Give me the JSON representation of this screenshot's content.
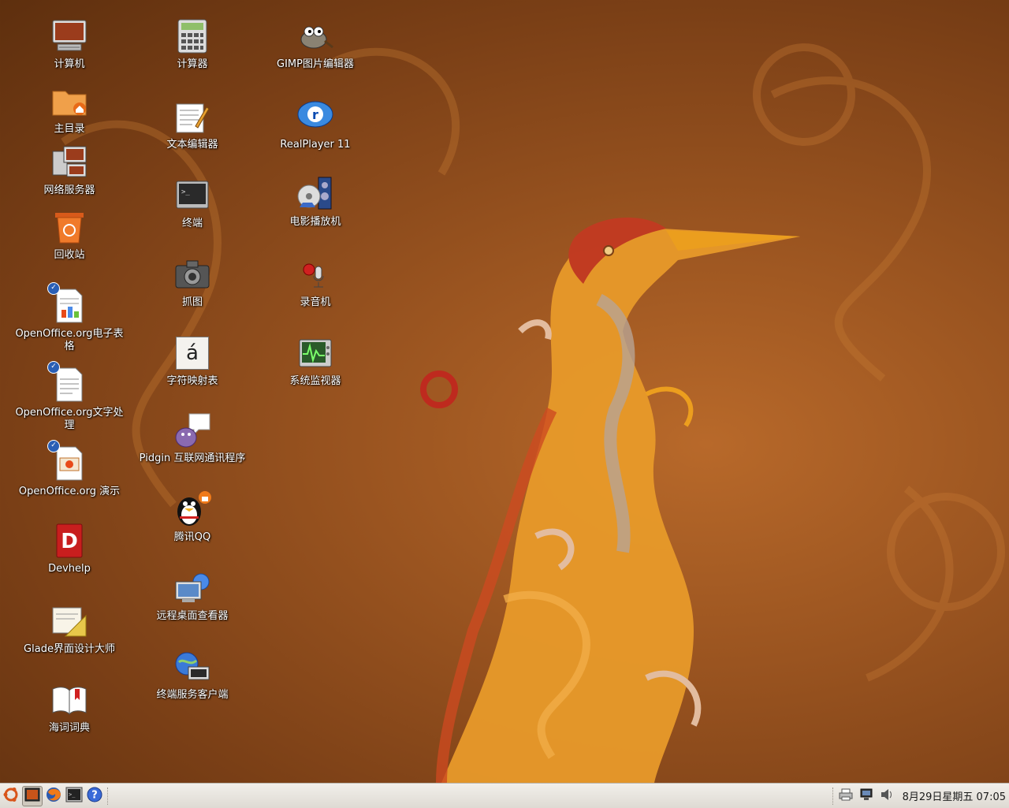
{
  "desktop": {
    "col1": [
      {
        "label": "计算机",
        "icon": "computer-icon"
      },
      {
        "label": "主目录",
        "icon": "home-folder-icon"
      },
      {
        "label": "网络服务器",
        "icon": "network-servers-icon"
      },
      {
        "label": "回收站",
        "icon": "trash-icon"
      },
      {
        "label": "OpenOffice.org电子表格",
        "icon": "spreadsheet-icon"
      },
      {
        "label": "OpenOffice.org文字处理",
        "icon": "word-processor-icon"
      },
      {
        "label": "OpenOffice.org 演示",
        "icon": "presentation-icon"
      },
      {
        "label": "Devhelp",
        "icon": "devhelp-icon"
      },
      {
        "label": "Glade界面设计大师",
        "icon": "glade-icon"
      },
      {
        "label": "海词词典",
        "icon": "dictionary-icon"
      }
    ],
    "col2": [
      {
        "label": "计算器",
        "icon": "calculator-icon"
      },
      {
        "label": "文本编辑器",
        "icon": "text-editor-icon"
      },
      {
        "label": "终端",
        "icon": "terminal-icon"
      },
      {
        "label": "抓图",
        "icon": "camera-icon"
      },
      {
        "label": "字符映射表",
        "icon": "character-map-icon",
        "glyph": "á"
      },
      {
        "label": "Pidgin 互联网通讯程序",
        "icon": "pidgin-icon"
      },
      {
        "label": "腾讯QQ",
        "icon": "qq-penguin-icon"
      },
      {
        "label": "远程桌面查看器",
        "icon": "remote-desktop-icon"
      },
      {
        "label": "终端服务客户端",
        "icon": "terminal-server-client-icon"
      }
    ],
    "col3": [
      {
        "label": "GIMP图片编辑器",
        "icon": "gimp-icon"
      },
      {
        "label": "RealPlayer 11",
        "icon": "realplayer-icon"
      },
      {
        "label": "电影播放机",
        "icon": "movie-player-icon"
      },
      {
        "label": "录音机",
        "icon": "sound-recorder-icon"
      },
      {
        "label": "系统监视器",
        "icon": "system-monitor-icon"
      }
    ]
  },
  "panel": {
    "launchers": [
      "ubuntu-menu-icon",
      "show-desktop-icon",
      "firefox-icon",
      "terminal-launcher-icon",
      "help-icon"
    ],
    "tray": [
      "printer-icon",
      "network-icon",
      "volume-icon"
    ],
    "clock": "8月29日星期五 07:05"
  },
  "colors": {
    "wallpaper": "#9a5420",
    "panel": "#e8e5e0"
  }
}
